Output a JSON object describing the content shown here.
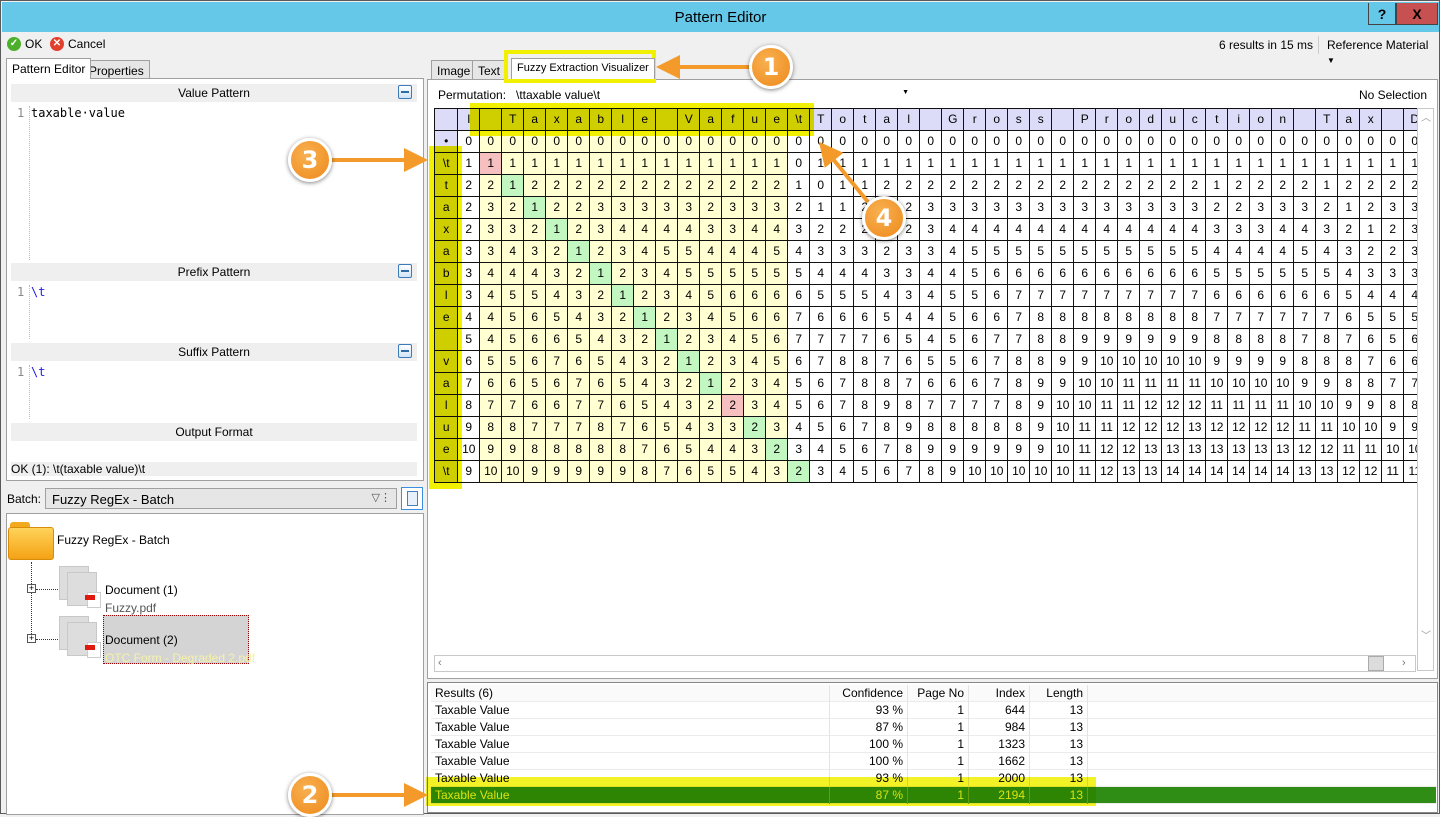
{
  "window": {
    "title": "Pattern Editor",
    "help_label": "?",
    "close_label": "X"
  },
  "toolbar": {
    "ok_label": "OK",
    "cancel_label": "Cancel",
    "status": "6 results in 15 ms",
    "reference_label": "Reference Material"
  },
  "left_tabs": [
    "Pattern Editor",
    "Properties"
  ],
  "editor": {
    "value_pattern": {
      "title": "Value Pattern",
      "line": "1",
      "text": "taxable·value"
    },
    "prefix_pattern": {
      "title": "Prefix Pattern",
      "line": "1",
      "text": "\\t"
    },
    "suffix_pattern": {
      "title": "Suffix Pattern",
      "line": "1",
      "text": "\\t"
    },
    "output_format": {
      "title": "Output Format"
    },
    "status": "OK (1): \\t(taxable value)\\t"
  },
  "batch": {
    "label": "Batch:",
    "selected": "Fuzzy RegEx - Batch",
    "tree": {
      "root": "Fuzzy RegEx - Batch",
      "documents": [
        {
          "name": "Document (1)",
          "file": "Fuzzy.pdf"
        },
        {
          "name": "Document (2)",
          "file": "OTC Form - Degraded 2.pdf"
        }
      ]
    }
  },
  "right_tabs": [
    "Image",
    "Text",
    "Fuzzy Extraction Visualizer"
  ],
  "visualizer": {
    "permutation_label": "Permutation:",
    "permutation_value": "\\ttaxable value\\t",
    "selection": "No Selection",
    "column_labels": [
      "I",
      " ",
      "T",
      "a",
      "x",
      "a",
      "b",
      "l",
      "e",
      " ",
      "V",
      "a",
      "f",
      "u",
      "e",
      "\\t",
      "T",
      "o",
      "t",
      "a",
      "l",
      " ",
      "G",
      "r",
      "o",
      "s",
      "s",
      " ",
      "P",
      "r",
      "o",
      "d",
      "u",
      "c",
      "t",
      "i",
      "o",
      "n",
      " ",
      "T",
      "a",
      "x",
      " ",
      "D"
    ],
    "row_labels": [
      "•",
      "\\t",
      "t",
      "a",
      "x",
      "a",
      "b",
      "l",
      "e",
      " ",
      "v",
      "a",
      "l",
      "u",
      "e",
      "\\t"
    ],
    "matrix": [
      "0 0 0 0 0 0 0 0 0 0 0 0 0 0 0 0 0 0 0 0 0 0 0 0 0 0 0 0 0 0 0 0 0 0 0 0 0 0 0 0 0 0 0 0",
      "1 1 1 1 1 1 1 1 1 1 1 1 1 1 1 0 1 1 1 1 1 1 1 1 1 1 1 1 1 1 1 1 1 1 1 1 1 1 1 1 1 1 1 1",
      "2 2 1 2 2 2 2 2 2 2 2 2 2 2 2 1 0 1 1 2 2 2 2 2 2 2 2 2 2 2 2 2 2 2 1 2 2 2 2 1 2 2 2 2",
      "2 3 2 1 2 2 3 3 3 3 3 2 3 3 3 2 1 1 2 1 2 3 3 3 3 3 3 3 3 3 3 3 3 3 2 2 3 3 3 2 1 2 3 3",
      "2 3 3 2 1 2 3 4 4 4 4 3 3 4 4 3 2 2 2 2 2 3 4 4 4 4 4 4 4 4 4 4 4 4 3 3 3 4 4 3 2 1 2 3",
      "3 3 4 3 2 1 2 3 4 5 5 4 4 4 5 4 3 3 3 2 3 3 4 5 5 5 5 5 5 5 5 5 5 5 4 4 4 4 5 4 3 2 2 3",
      "3 4 4 4 3 2 1 2 3 4 5 5 5 5 5 5 4 4 4 3 3 4 4 5 6 6 6 6 6 6 6 6 6 6 5 5 5 5 5 5 4 3 3 3",
      "3 4 5 5 4 3 2 1 2 3 4 5 6 6 6 6 5 5 5 4 3 4 5 5 6 7 7 7 7 7 7 7 7 7 6 6 6 6 6 6 5 4 4 4",
      "4 4 5 6 5 4 3 2 1 2 3 4 5 6 6 7 6 6 6 5 4 4 5 6 6 7 8 8 8 8 8 8 8 8 7 7 7 7 7 7 6 5 5 5",
      "5 4 5 6 6 5 4 3 2 1 2 3 4 5 6 7 7 7 7 6 5 4 5 6 7 7 8 8 9 9 9 9 9 9 8 8 8 8 7 8 7 6 5 6",
      "6 5 5 6 7 6 5 4 3 2 1 2 3 4 5 6 7 8 8 7 6 5 5 6 7 8 8 9 9 10 10 10 10 10 9 9 9 9 8 8 8 7 6 6",
      "7 6 6 5 6 7 6 5 4 3 2 1 2 3 4 5 6 7 8 8 7 6 6 6 7 8 9 9 10 10 11 11 11 11 10 10 10 10 9 9 8 8 7 7",
      "8 7 7 6 6 7 7 6 5 4 3 2 2 3 4 5 6 7 8 9 8 7 7 7 7 8 9 10 10 11 11 12 12 12 11 11 11 11 10 10 9 9 8 8",
      "9 8 8 7 7 7 8 7 6 5 4 3 3 2 3 4 5 6 7 8 9 8 8 8 8 8 9 10 11 11 12 12 12 13 12 12 12 12 11 11 10 10 9 9",
      "10 9 9 8 8 8 8 8 7 6 5 4 4 3 2 3 4 5 6 7 8 9 9 9 9 9 9 10 11 12 12 13 13 13 13 13 13 13 12 12 11 11 10 10",
      "9 10 10 9 9 9 9 9 8 7 6 5 5 4 3 2 3 4 5 6 7 8 9 10 10 10 10 10 11 12 13 13 14 14 14 14 14 14 13 13 12 12 11 11"
    ],
    "match_columns": [
      2,
      15
    ],
    "path_cells": [
      {
        "row": 1,
        "col": 2,
        "kind": "substitution"
      },
      {
        "row": 2,
        "col": 3,
        "kind": "match"
      },
      {
        "row": 3,
        "col": 4,
        "kind": "match"
      },
      {
        "row": 4,
        "col": 5,
        "kind": "match"
      },
      {
        "row": 5,
        "col": 6,
        "kind": "match"
      },
      {
        "row": 6,
        "col": 7,
        "kind": "match"
      },
      {
        "row": 7,
        "col": 8,
        "kind": "match"
      },
      {
        "row": 8,
        "col": 9,
        "kind": "match"
      },
      {
        "row": 9,
        "col": 10,
        "kind": "match"
      },
      {
        "row": 10,
        "col": 11,
        "kind": "match"
      },
      {
        "row": 11,
        "col": 12,
        "kind": "match"
      },
      {
        "row": 12,
        "col": 13,
        "kind": "substitution"
      },
      {
        "row": 13,
        "col": 14,
        "kind": "match"
      },
      {
        "row": 14,
        "col": 15,
        "kind": "match"
      },
      {
        "row": 15,
        "col": 16,
        "kind": "match"
      }
    ],
    "colors": {
      "header": "#dcdcf8",
      "match_region": "#ffffd2",
      "match": "#c2f7c2",
      "substitution": "#f7c0c0"
    }
  },
  "results": {
    "headers": [
      "Results (6)",
      "Confidence",
      "Page No",
      "Index",
      "Length"
    ],
    "rows": [
      [
        "Taxable Value",
        "93 %",
        "1",
        "644",
        "13"
      ],
      [
        "Taxable Value",
        "87 %",
        "1",
        "984",
        "13"
      ],
      [
        "Taxable Value",
        "100 %",
        "1",
        "1323",
        "13"
      ],
      [
        "Taxable Value",
        "100 %",
        "1",
        "1662",
        "13"
      ],
      [
        "Taxable Value",
        "93 %",
        "1",
        "2000",
        "13"
      ],
      [
        "Taxable Value",
        "87 %",
        "1",
        "2194",
        "13"
      ]
    ],
    "selected_index": 5,
    "selected_bg": "#2f8c14",
    "selected_fg": "#e6f05a"
  },
  "annotations": [
    "1",
    "2",
    "3",
    "4"
  ]
}
